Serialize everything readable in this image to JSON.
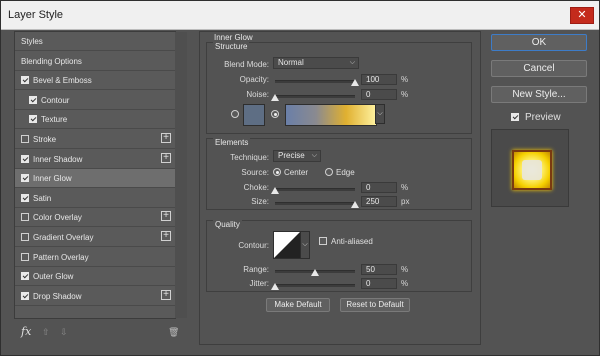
{
  "window": {
    "title": "Layer Style",
    "close_glyph": "✕"
  },
  "sidebar": {
    "items": [
      {
        "label": "Styles",
        "has_checkbox": false,
        "checked": false,
        "has_plus": false,
        "selected": false
      },
      {
        "label": "Blending Options",
        "has_checkbox": false,
        "checked": false,
        "has_plus": false,
        "selected": false
      },
      {
        "label": "Bevel & Emboss",
        "has_checkbox": true,
        "checked": true,
        "has_plus": false,
        "selected": false
      },
      {
        "label": "Contour",
        "has_checkbox": true,
        "checked": true,
        "has_plus": false,
        "selected": false,
        "indent": true
      },
      {
        "label": "Texture",
        "has_checkbox": true,
        "checked": true,
        "has_plus": false,
        "selected": false,
        "indent": true
      },
      {
        "label": "Stroke",
        "has_checkbox": true,
        "checked": false,
        "has_plus": true,
        "selected": false
      },
      {
        "label": "Inner Shadow",
        "has_checkbox": true,
        "checked": true,
        "has_plus": true,
        "selected": false
      },
      {
        "label": "Inner Glow",
        "has_checkbox": true,
        "checked": true,
        "has_plus": false,
        "selected": true
      },
      {
        "label": "Satin",
        "has_checkbox": true,
        "checked": true,
        "has_plus": false,
        "selected": false
      },
      {
        "label": "Color Overlay",
        "has_checkbox": true,
        "checked": false,
        "has_plus": true,
        "selected": false
      },
      {
        "label": "Gradient Overlay",
        "has_checkbox": true,
        "checked": false,
        "has_plus": true,
        "selected": false
      },
      {
        "label": "Pattern Overlay",
        "has_checkbox": true,
        "checked": false,
        "has_plus": false,
        "selected": false
      },
      {
        "label": "Outer Glow",
        "has_checkbox": true,
        "checked": true,
        "has_plus": false,
        "selected": false
      },
      {
        "label": "Drop Shadow",
        "has_checkbox": true,
        "checked": true,
        "has_plus": true,
        "selected": false
      }
    ],
    "footer": {
      "fx_label": "fx",
      "up_glyph": "⇧",
      "down_glyph": "⇩",
      "trash_glyph": "🗑"
    }
  },
  "panel": {
    "section_title": "Inner Glow",
    "structure": {
      "title": "Structure",
      "blend_mode_label": "Blend Mode:",
      "blend_mode_value": "Normal",
      "opacity_label": "Opacity:",
      "opacity_value": "100",
      "opacity_fraction": 1.0,
      "noise_label": "Noise:",
      "noise_value": "0",
      "noise_fraction": 0.0,
      "percent": "%",
      "color_swatch": "#5e6e84",
      "gradient_colors": [
        "#6a7fa8",
        "#8a8a90",
        "#e0b030",
        "#fff2a0"
      ]
    },
    "elements": {
      "title": "Elements",
      "technique_label": "Technique:",
      "technique_value": "Precise",
      "source_label": "Source:",
      "source_center": "Center",
      "source_edge": "Edge",
      "choke_label": "Choke:",
      "choke_value": "0",
      "choke_fraction": 0.0,
      "size_label": "Size:",
      "size_value": "250",
      "size_fraction": 1.0,
      "percent": "%",
      "px": "px"
    },
    "quality": {
      "title": "Quality",
      "contour_label": "Contour:",
      "antialias_label": "Anti-aliased",
      "range_label": "Range:",
      "range_value": "50",
      "range_fraction": 0.5,
      "jitter_label": "Jitter:",
      "jitter_value": "0",
      "jitter_fraction": 0.0,
      "percent": "%"
    },
    "make_default": "Make Default",
    "reset_default": "Reset to Default"
  },
  "actions": {
    "ok": "OK",
    "cancel": "Cancel",
    "new_style": "New Style...",
    "preview_label": "Preview",
    "preview_checked": true
  },
  "colors": {
    "accent": "#3d7cc8",
    "close": "#c42b1c",
    "glow": "#f5d000"
  }
}
